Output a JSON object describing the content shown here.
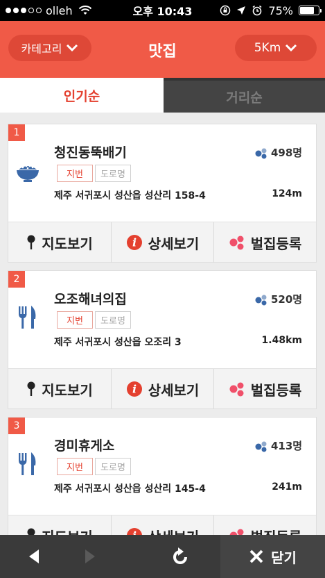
{
  "status_bar": {
    "carrier": "olleh",
    "time": "오후 10:43",
    "battery": "75%",
    "battery_level": 0.75
  },
  "header": {
    "category_label": "카테고리",
    "title": "맛집",
    "distance_filter": "5Km"
  },
  "tabs": [
    {
      "label": "인기순",
      "active": true
    },
    {
      "label": "거리순",
      "active": false
    }
  ],
  "accent_color": "#f05a47",
  "restaurants": [
    {
      "rank": "1",
      "name": "청진동뚝배기",
      "count": "498명",
      "address": "제주 서귀포시 성산읍 성산리 158-4",
      "distance": "124m",
      "icon": "bowl-icon"
    },
    {
      "rank": "2",
      "name": "오조해녀의집",
      "count": "520명",
      "address": "제주 서귀포시 성산읍 오조리 3",
      "distance": "1.48km",
      "icon": "fork-knife-icon"
    },
    {
      "rank": "3",
      "name": "경미휴게소",
      "count": "413명",
      "address": "제주 서귀포시 성산읍 성산리 145-4",
      "distance": "241m",
      "icon": "fork-knife-icon"
    }
  ],
  "badges": {
    "jibun": "지번",
    "doro": "도로명"
  },
  "actions": {
    "map": "지도보기",
    "detail": "상세보기",
    "register": "벌집등록"
  },
  "bottom_bar": {
    "close_label": "닫기"
  }
}
